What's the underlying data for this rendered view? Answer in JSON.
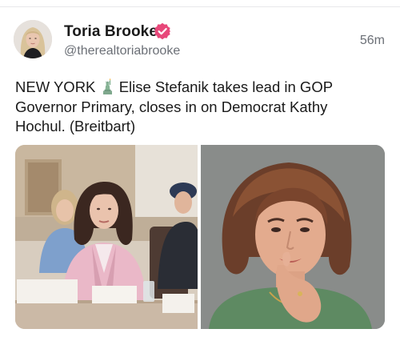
{
  "post": {
    "author_name": "Toria Brooke",
    "author_handle": "@therealtoriabrooke",
    "timestamp": "56m",
    "verified": true,
    "text_lines": [
      "NEW YORK",
      "Elise Stefanik takes lead in GOP",
      "Governor Primary, closes in on Democrat Kathy",
      "Hochul. (Breitbart)"
    ],
    "inline_emoji": "statue-of-liberty-icon",
    "media": [
      {
        "name": "photo-left"
      },
      {
        "name": "photo-right"
      }
    ]
  },
  "colors": {
    "name": "#1a1a1a",
    "muted": "#6b6f76",
    "verified_badge": "#e8487a",
    "divider": "#e8e8ea"
  }
}
